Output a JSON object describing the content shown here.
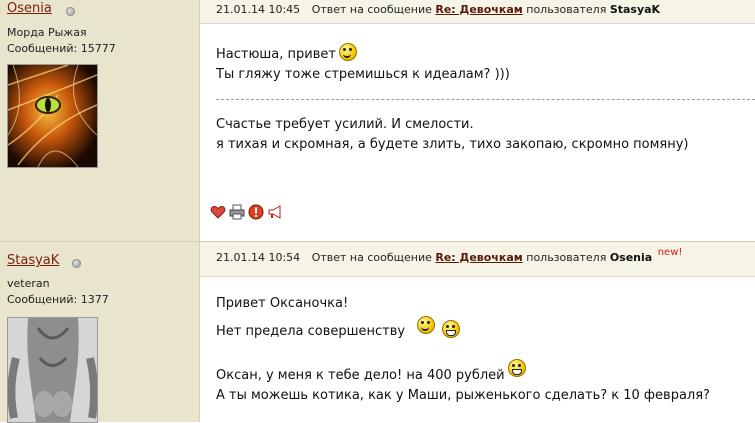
{
  "posts": [
    {
      "author": "Osenia",
      "rank": "Морда Рыжая",
      "messages": "Сообщений: 15777",
      "date": "21.01.14 10:45",
      "reply_prefix": "Ответ на сообщение",
      "reply_title": "Re: Девочкам",
      "user_prefix": "пользователя",
      "reply_user": "StasyaK",
      "paragraph1": [
        "Настюша, привет",
        "Ты гляжу тоже стремишься к идеалам? )))"
      ],
      "paragraph2": [
        "Счастье требует усилий. И смелости.",
        "я тихая и скромная, а будете злить, тихо закопаю, скромно помяну)"
      ]
    },
    {
      "author": "StasyaK",
      "rank": "veteran",
      "messages": "Сообщений: 1377",
      "date": "21.01.14 10:54",
      "reply_prefix": "Ответ на сообщение",
      "reply_title": "Re: Девочкам",
      "user_prefix": "пользователя",
      "reply_user": "Osenia",
      "badge": "new!",
      "lines": [
        "Привет Оксаночка!",
        "Нет предела совершенству",
        "Оксан, у меня к тебе дело! на 400 рублей",
        "А ты можешь котика, как у Маши, рыженького сделать? к 10 февраля?"
      ]
    }
  ],
  "icons": [
    "heart-icon",
    "printer-icon",
    "warning-icon",
    "megaphone-icon",
    "smiley-wink-icon",
    "smiley-grin-icon",
    "online-status-icon"
  ]
}
